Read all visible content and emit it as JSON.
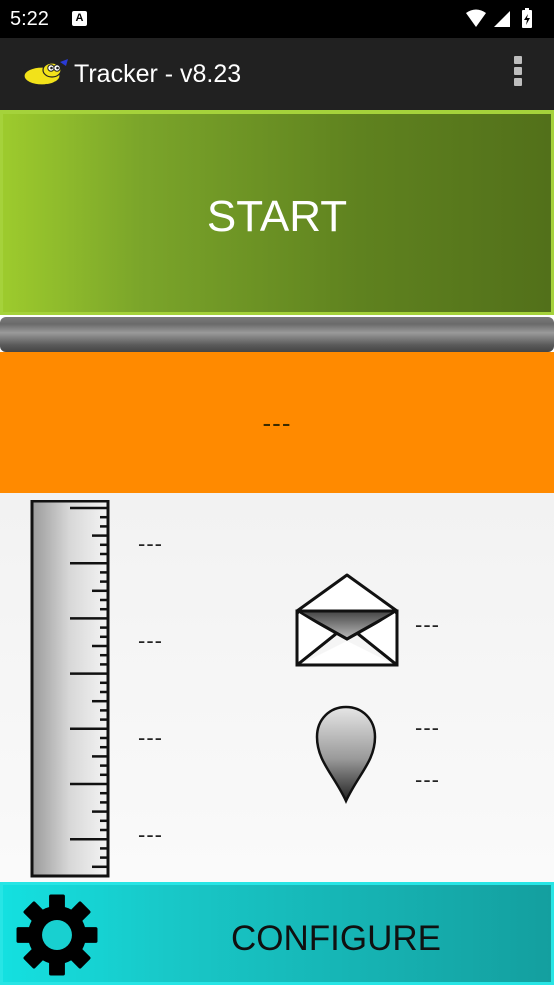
{
  "status_bar": {
    "time": "5:22",
    "notification": "A"
  },
  "app_bar": {
    "title": "Tracker - v8.23"
  },
  "start_button": {
    "label": "START",
    "color": "#6b8f22"
  },
  "status_panel": {
    "value": "---",
    "color": "#ff8a00"
  },
  "stats": {
    "ruler_values": [
      "---",
      "---",
      "---",
      "---"
    ],
    "messages_value": "---",
    "location_values": [
      "---",
      "---"
    ]
  },
  "configure_button": {
    "label": "CONFIGURE",
    "color": "#18c8c8"
  },
  "icons": [
    "tracker-logo-icon",
    "overflow-menu-icon",
    "ruler-icon",
    "envelope-icon",
    "map-pin-icon",
    "gear-icon"
  ]
}
